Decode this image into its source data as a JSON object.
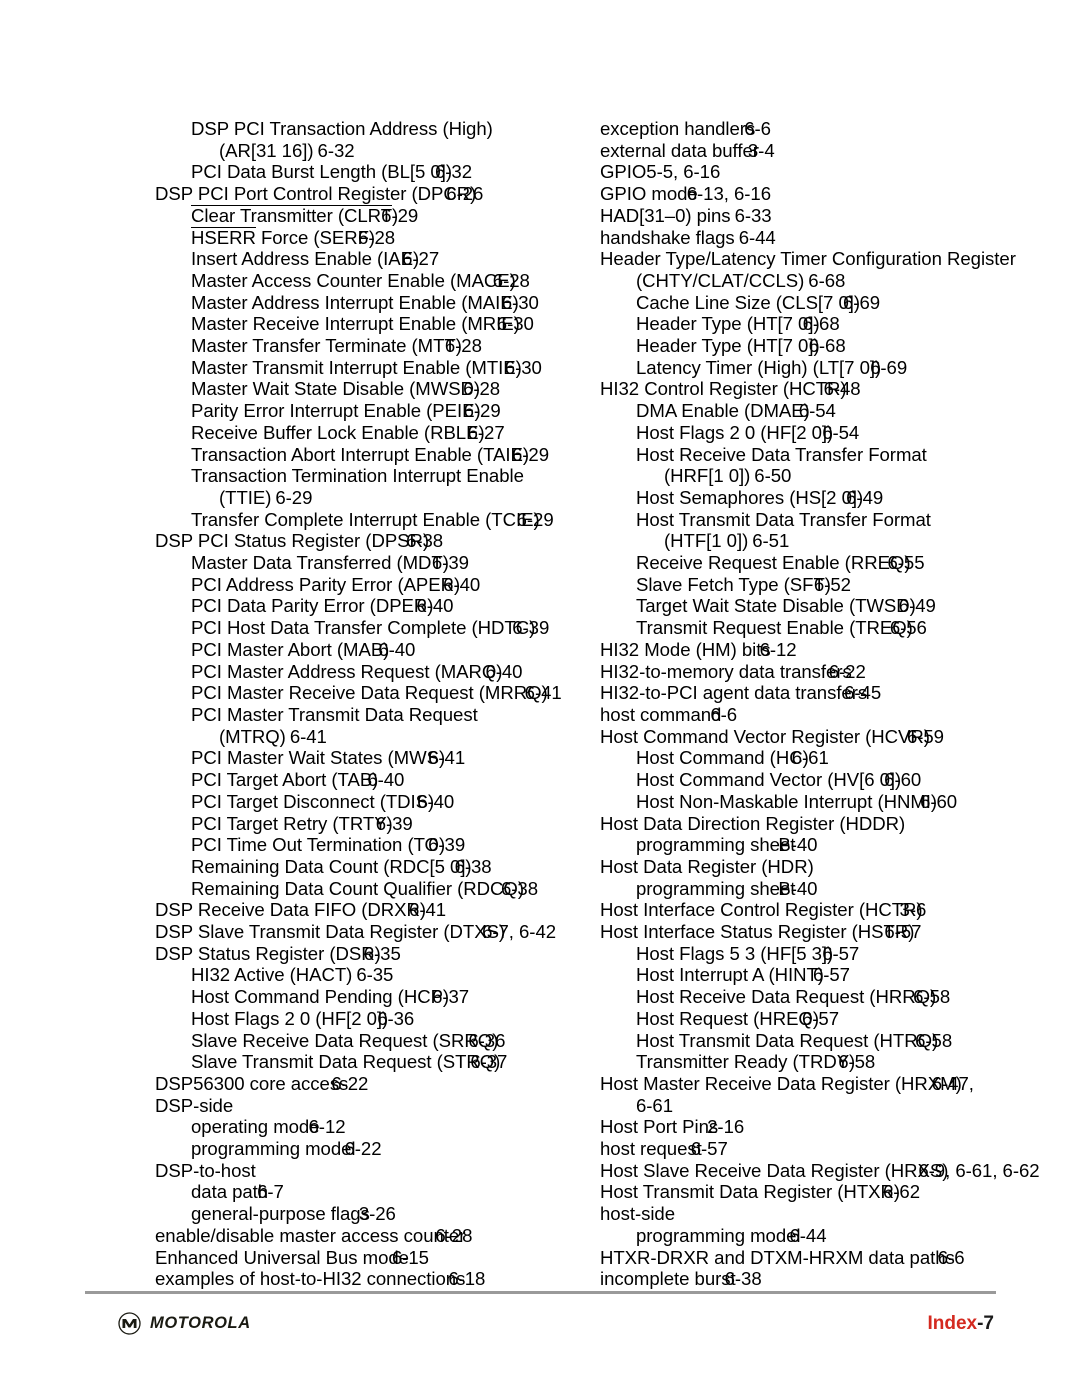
{
  "document": {
    "kind": "book-index-page",
    "folio_label": "Index",
    "folio_separator": "-",
    "folio_number": "7",
    "brand": "MOTOROLA",
    "brand_mark": "motorola-m-logo",
    "accent_color": "#d42a20",
    "rule_color": "#9a9a9a"
  },
  "columns": {
    "left": [
      {
        "level": 1,
        "text": "DSP PCI Transaction Address (High)",
        "page": "",
        "overlap": "ov0"
      },
      {
        "level": 2,
        "text": "(AR[31 16])",
        "page": "6-32",
        "overlap": "sp1"
      },
      {
        "level": 1,
        "text": "PCI Data Burst Length (BL[5 0])",
        "page": "6-32",
        "overlap": "ov2"
      },
      {
        "level": 0,
        "text": "DSP PCI Port Control Register (DPCR)",
        "page": "6-26",
        "overlap": "ov4"
      },
      {
        "level": 1,
        "text": "Clear Transmitter (CLRT)",
        "page": "6-29",
        "overlap": "ov2",
        "overbar": "Clear Transmitter (CLRT"
      },
      {
        "level": 1,
        "text": "HSERR Force (SERF)",
        "page": "6-28",
        "overlap": "ov2",
        "overbar": "HSERR"
      },
      {
        "level": 1,
        "text": "Insert Address Enable (IAE)",
        "page": "6-27",
        "overlap": "ov2"
      },
      {
        "level": 1,
        "text": "Master Access Counter Enable (MACE)",
        "page": "6-28",
        "overlap": "ov3"
      },
      {
        "level": 1,
        "text": "Master Address Interrupt Enable (MAIE)",
        "page": "6-30",
        "overlap": "ov2"
      },
      {
        "level": 1,
        "text": "Master Receive Interrupt Enable (MRIE)",
        "page": "6-30",
        "overlap": "ov3"
      },
      {
        "level": 1,
        "text": "Master Transfer Terminate (MTT)",
        "page": "6-28",
        "overlap": "ov2"
      },
      {
        "level": 1,
        "text": "Master Transmit Interrupt Enable (MTIE)",
        "page": "6-30",
        "overlap": "ov2"
      },
      {
        "level": 1,
        "text": "Master Wait State Disable (MWSD)",
        "page": "6-28",
        "overlap": "ov2"
      },
      {
        "level": 1,
        "text": "Parity Error Interrupt Enable (PEIE)",
        "page": "6-29",
        "overlap": "ov2"
      },
      {
        "level": 1,
        "text": "Receive Buffer Lock Enable (RBLE)",
        "page": "6-27",
        "overlap": "ov2"
      },
      {
        "level": 1,
        "text": "Transaction Abort Interrupt Enable (TAIE)",
        "page": "6-29",
        "overlap": "ov2"
      },
      {
        "level": 1,
        "text": "Transaction Termination Interrupt Enable",
        "page": "",
        "overlap": "ov0"
      },
      {
        "level": 2,
        "text": "(TTIE)",
        "page": "6-29",
        "overlap": "sp1"
      },
      {
        "level": 1,
        "text": "Transfer Complete Interrupt Enable (TCIE)",
        "page": "6-29",
        "overlap": "ov3"
      },
      {
        "level": 0,
        "text": "DSP PCI Status Register (DPSR)",
        "page": "6-38",
        "overlap": "ov3"
      },
      {
        "level": 1,
        "text": "Master Data Transferred (MDT)",
        "page": "6-39",
        "overlap": "ov2"
      },
      {
        "level": 1,
        "text": "PCI Address Parity Error (APER)",
        "page": "6-40",
        "overlap": "ov2"
      },
      {
        "level": 1,
        "text": "PCI Data Parity Error (DPER)",
        "page": "6-40",
        "overlap": "ov2"
      },
      {
        "level": 1,
        "text": "PCI Host Data Transfer Complete (HDTC)",
        "page": "6-39",
        "overlap": "ov3"
      },
      {
        "level": 1,
        "text": "PCI Master Abort (MAB)",
        "page": "6-40",
        "overlap": "ov1"
      },
      {
        "level": 1,
        "text": "PCI Master Address Request (MARQ)",
        "page": "6-40",
        "overlap": "ov2"
      },
      {
        "level": 1,
        "text": "PCI Master Receive Data Request (MRRQ)",
        "page": "6-41",
        "overlap": "ov3"
      },
      {
        "level": 1,
        "text": "PCI Master Transmit Data Request",
        "page": "",
        "overlap": "ov0"
      },
      {
        "level": 2,
        "text": "(MTRQ)",
        "page": "6-41",
        "overlap": "sp1"
      },
      {
        "level": 1,
        "text": "PCI Master Wait States (MWS)",
        "page": "6-41",
        "overlap": "ov2"
      },
      {
        "level": 1,
        "text": "PCI Target Abort (TAB)",
        "page": "6-40",
        "overlap": "ov1"
      },
      {
        "level": 1,
        "text": "PCI Target Disconnect (TDIS)",
        "page": "6-40",
        "overlap": "ov2"
      },
      {
        "level": 1,
        "text": "PCI Target Retry (TRTY)",
        "page": "6-39",
        "overlap": "ov2"
      },
      {
        "level": 1,
        "text": "PCI Time Out Termination (TO)",
        "page": "6-39",
        "overlap": "ov2"
      },
      {
        "level": 1,
        "text": "Remaining Data Count (RDC[5 0])",
        "page": "6-38",
        "overlap": "ov2"
      },
      {
        "level": 1,
        "text": "Remaining Data Count Qualifier (RDCQ)",
        "page": "6-38",
        "overlap": "ov3"
      },
      {
        "level": 0,
        "text": "DSP Receive Data FIFO (DRXR)",
        "page": "6-41",
        "overlap": "ov2"
      },
      {
        "level": 0,
        "text": "DSP Slave Transmit Data Register (DTXS)",
        "page": "6-7, 6-42",
        "overlap": "ov3"
      },
      {
        "level": 0,
        "text": "DSP Status Register (DSR)",
        "page": "6-35",
        "overlap": "ov2"
      },
      {
        "level": 1,
        "text": "HI32 Active (HACT)",
        "page": "6-35",
        "overlap": "sp1"
      },
      {
        "level": 1,
        "text": "Host Command Pending (HCP)",
        "page": "6-37",
        "overlap": "ov2"
      },
      {
        "level": 1,
        "text": "Host Flags 2 0 (HF[2 0])",
        "page": "6-36",
        "overlap": "ov1"
      },
      {
        "level": 1,
        "text": "Slave Receive Data Request (SRRQ)",
        "page": "6-36",
        "overlap": "ov4"
      },
      {
        "level": 1,
        "text": "Slave Transmit Data Request (STRQ)",
        "page": "6-37",
        "overlap": "ov4"
      },
      {
        "level": 0,
        "text": "DSP56300 core access",
        "page": "6-22",
        "overlap": "ov2"
      },
      {
        "level": 0,
        "text": "DSP-side",
        "page": "",
        "overlap": "ov0"
      },
      {
        "level": 1,
        "text": "operating mode",
        "page": "6-12",
        "overlap": "ov1"
      },
      {
        "level": 1,
        "text": "programming model",
        "page": "6-22",
        "overlap": "ov1"
      },
      {
        "level": 0,
        "text": "DSP-to-host",
        "page": "",
        "overlap": "ov0"
      },
      {
        "level": 1,
        "text": "data path",
        "page": "6-7",
        "overlap": "ov1"
      },
      {
        "level": 1,
        "text": "general-purpose flags",
        "page": "3-26",
        "overlap": "ov1"
      },
      {
        "level": 0,
        "text": "enable/disable master access counter",
        "page": "6-28",
        "overlap": "ov4"
      },
      {
        "level": 0,
        "text": "Enhanced Universal Bus mode",
        "page": "6-15",
        "overlap": "ov2"
      },
      {
        "level": 0,
        "text": "examples of host-to-HI32 connections",
        "page": "6-18",
        "overlap": "ov2"
      }
    ],
    "right": [
      {
        "level": 0,
        "text": "exception handlers",
        "page": "6-6",
        "overlap": "ov1"
      },
      {
        "level": 0,
        "text": "external data buffer",
        "page": "3-4",
        "overlap": "ov1"
      },
      {
        "level": 0,
        "text": "GPIO",
        "page": "5-5, 6-16",
        "overlap": "ov0"
      },
      {
        "level": 0,
        "text": "GPIO mode",
        "page": "6-13, 6-16",
        "overlap": "ov1"
      },
      {
        "level": 0,
        "text": "HAD[31–0) pins",
        "page": "6-33",
        "overlap": "sp1"
      },
      {
        "level": 0,
        "text": "handshake flags",
        "page": "6-44",
        "overlap": "sp1"
      },
      {
        "level": 0,
        "text": "Header Type/Latency Timer Configuration Register",
        "page": "",
        "overlap": "ov0"
      },
      {
        "level": 1,
        "text": "(CHTY/CLAT/CCLS)",
        "page": "6-68",
        "overlap": "sp1"
      },
      {
        "level": 1,
        "text": "Cache Line Size (CLS[7 0])",
        "page": "6-69",
        "overlap": "ov2"
      },
      {
        "level": 1,
        "text": "Header Type (HT[7 0])",
        "page": "6-68",
        "overlap": "ov2"
      },
      {
        "level": 1,
        "text": "Header Type (HT[7 0])",
        "page": "6-68",
        "overlap": "ov1"
      },
      {
        "level": 1,
        "text": "Latency Timer (High) (LT[7 0])",
        "page": "6-69",
        "overlap": "ov1"
      },
      {
        "level": 0,
        "text": "HI32 Control Register (HCTR)",
        "page": "6-48",
        "overlap": "ov3"
      },
      {
        "level": 1,
        "text": "DMA Enable (DMAE)",
        "page": "6-54",
        "overlap": "ov1"
      },
      {
        "level": 1,
        "text": "Host Flags 2 0 (HF[2 0])",
        "page": "6-54",
        "overlap": "ov1"
      },
      {
        "level": 1,
        "text": "Host Receive Data Transfer Format",
        "page": "",
        "overlap": "ov0"
      },
      {
        "level": 2,
        "text": "(HRF[1 0])",
        "page": "6-50",
        "overlap": "sp1"
      },
      {
        "level": 1,
        "text": "Host Semaphores (HS[2 0])",
        "page": "6-49",
        "overlap": "ov2"
      },
      {
        "level": 1,
        "text": "Host Transmit Data Transfer Format",
        "page": "",
        "overlap": "ov0"
      },
      {
        "level": 2,
        "text": "(HTF[1 0])",
        "page": "6-51",
        "overlap": "sp1"
      },
      {
        "level": 1,
        "text": "Receive Request Enable (RREQ)",
        "page": "6-55",
        "overlap": "ov3"
      },
      {
        "level": 1,
        "text": "Slave Fetch Type (SFT)",
        "page": "6-52",
        "overlap": "ov2"
      },
      {
        "level": 1,
        "text": "Target Wait State Disable (TWSD)",
        "page": "6-49",
        "overlap": "ov2"
      },
      {
        "level": 1,
        "text": "Transmit Request Enable (TREQ)",
        "page": "6-56",
        "overlap": "ov3"
      },
      {
        "level": 0,
        "text": "HI32 Mode (HM) bits",
        "page": "6-12",
        "overlap": "ov1"
      },
      {
        "level": 0,
        "text": "HI32-to-memory data transfers",
        "page": "6-22",
        "overlap": "ov3"
      },
      {
        "level": 0,
        "text": "HI32-to-PCI agent data transfers",
        "page": "6-45",
        "overlap": "ov3"
      },
      {
        "level": 0,
        "text": "host command",
        "page": "6-6",
        "overlap": "ov1"
      },
      {
        "level": 0,
        "text": "Host Command Vector Register (HCVR)",
        "page": "6-59",
        "overlap": "ov3"
      },
      {
        "level": 1,
        "text": "Host Command (HC)",
        "page": "6-61",
        "overlap": "ov2"
      },
      {
        "level": 1,
        "text": "Host Command Vector (HV[6 0])",
        "page": "6-60",
        "overlap": "ov2"
      },
      {
        "level": 1,
        "text": "Host Non-Maskable Interrupt (HNMI)",
        "page": "6-60",
        "overlap": "ov2"
      },
      {
        "level": 0,
        "text": "Host Data Direction Register (HDDR)",
        "page": "",
        "overlap": "ov0"
      },
      {
        "level": 1,
        "text": "programming sheet",
        "page": "B-40",
        "overlap": "ov2"
      },
      {
        "level": 0,
        "text": "Host Data Register (HDR)",
        "page": "",
        "overlap": "ov0"
      },
      {
        "level": 1,
        "text": "programming sheet",
        "page": "B-40",
        "overlap": "ov2"
      },
      {
        "level": 0,
        "text": "Host Interface Control Register (HCTR)",
        "page": "3-6",
        "overlap": "ov3"
      },
      {
        "level": 0,
        "text": "Host Interface Status Register (HSTR)",
        "page": "6-57",
        "overlap": "ov4"
      },
      {
        "level": 1,
        "text": "Host Flags 5 3 (HF[5 3])",
        "page": "6-57",
        "overlap": "ov1"
      },
      {
        "level": 1,
        "text": "Host Interrupt A (HINT)",
        "page": "6-57",
        "overlap": "ov1"
      },
      {
        "level": 1,
        "text": "Host Receive Data Request (HRRQ)",
        "page": "6-58",
        "overlap": "ov3"
      },
      {
        "level": 1,
        "text": "Host Request (HREQ)",
        "page": "6-57",
        "overlap": "ov2"
      },
      {
        "level": 1,
        "text": "Host Transmit Data Request (HTRQ)",
        "page": "6-58",
        "overlap": "ov3"
      },
      {
        "level": 1,
        "text": "Transmitter Ready (TRDY)",
        "page": "6-58",
        "overlap": "ov2"
      },
      {
        "level": 0,
        "text": "Host Master Receive Data Register (HRXM)",
        "page": "6-47,",
        "overlap": "ov4"
      },
      {
        "level": 1,
        "text": "6-61",
        "page": "",
        "overlap": "ov0"
      },
      {
        "level": 0,
        "text": "Host Port Pins",
        "page": "2-16",
        "overlap": "ov1"
      },
      {
        "level": 0,
        "text": "host request",
        "page": "6-57",
        "overlap": "ov1"
      },
      {
        "level": 0,
        "text": "Host Slave Receive Data Register (HRXS)",
        "page": "6-9, 6-61, 6-62",
        "overlap": "ov4"
      },
      {
        "level": 0,
        "text": "Host Transmit Data Register (HTXR)",
        "page": "6-62",
        "overlap": "ov2"
      },
      {
        "level": 0,
        "text": "host-side",
        "page": "",
        "overlap": "ov0"
      },
      {
        "level": 1,
        "text": "programming model",
        "page": "6-44",
        "overlap": "ov1"
      },
      {
        "level": 0,
        "text": "HTXR-DRXR and DTXM-HRXM data paths",
        "page": "6-6",
        "overlap": "ov2"
      },
      {
        "level": 0,
        "text": "incomplete burst",
        "page": "6-38",
        "overlap": "ov1"
      }
    ]
  }
}
